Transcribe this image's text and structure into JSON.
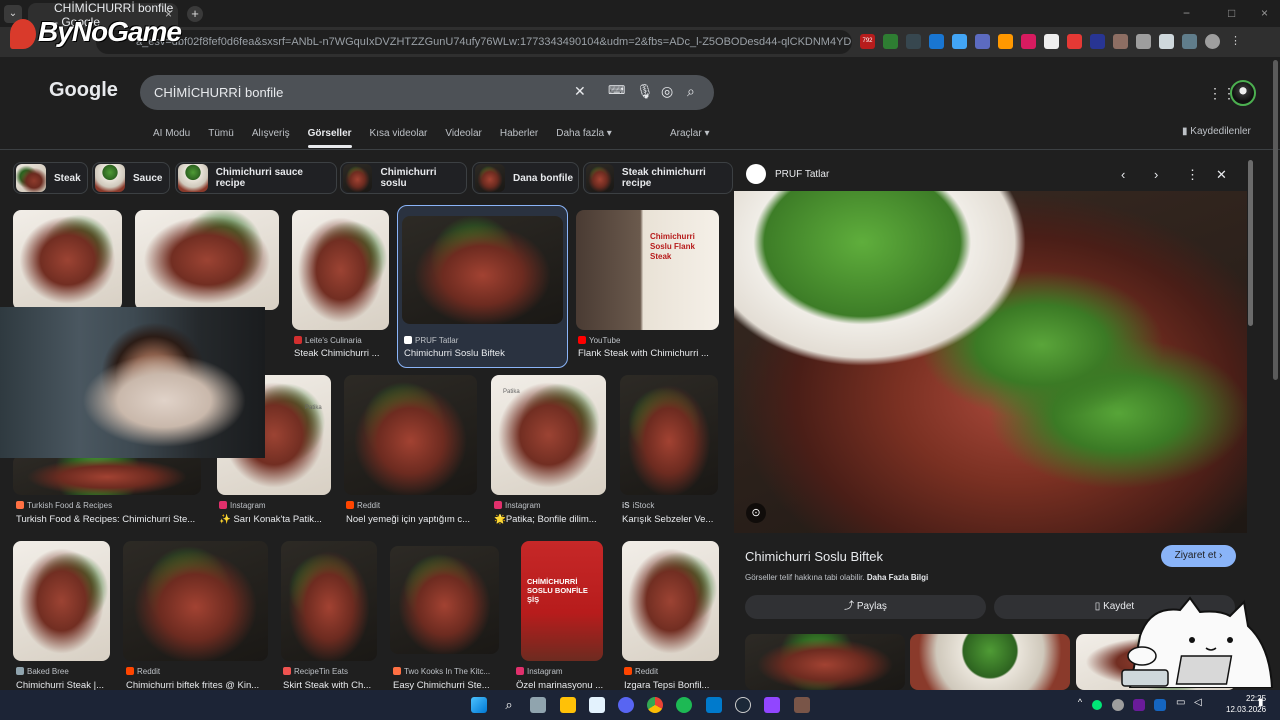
{
  "browser": {
    "tab_title": "CHİMİCHURRİ bonfile - Google",
    "tab_close": "×",
    "new_tab": "+",
    "tab_menu": "⌄",
    "url": "a_esv=dbf02f8fef0d6fea&sxsrf=ANbL-n7WGquIxDVZHTZZGunU74ufy76WLw:1773343490104&udm=2&fbs=ADc_l-Z5OBODesd44-qlCKDNM4YD...",
    "win_min": "−",
    "win_max": "□",
    "win_close": "×",
    "ext_badge": "792"
  },
  "overlay_logo": "ByNoGame",
  "google": {
    "logo": "Google",
    "query": "CHİMİCHURRİ bonfile",
    "nav_tabs": [
      "AI Modu",
      "Tümü",
      "Alışveriş",
      "Görseller",
      "Kısa videolar",
      "Videolar",
      "Haberler",
      "Daha fazla ▾"
    ],
    "tools": "Araçlar ▾",
    "saved": "Kaydedilenler"
  },
  "chips": [
    "Steak",
    "Sauce",
    "Chimichurri sauce recipe",
    "Chimichurri soslu",
    "Dana bonfile",
    "Steak chimichurri recipe"
  ],
  "results": [
    {
      "source": "",
      "title": ""
    },
    {
      "source": "",
      "title": ""
    },
    {
      "source": "Leite's Culinaria",
      "title": "Steak Chimichurri ..."
    },
    {
      "source": "PRUF Tatlar",
      "title": "Chimichurri Soslu Biftek"
    },
    {
      "source": "YouTube",
      "title": "Flank Steak with Chimichurri ..."
    },
    {
      "source": "Turkish Food & Recipes",
      "title": "Turkish Food & Recipes: Chimichurri Ste..."
    },
    {
      "source": "Instagram",
      "title": "✨ Sarı Konak'ta Patik..."
    },
    {
      "source": "Reddit",
      "title": "Noel yemeği için yaptığım c..."
    },
    {
      "source": "Instagram",
      "title": "🌟Patika; Bonfile dilim..."
    },
    {
      "source": "iStock",
      "title": "Karışık Sebzeler Ve..."
    },
    {
      "source": "Baked Bree",
      "title": "Chimichurri Steak |..."
    },
    {
      "source": "Reddit",
      "title": "Chimichurri biftek frites @ Kin..."
    },
    {
      "source": "RecipeTin Eats",
      "title": "Skirt Steak with Ch..."
    },
    {
      "source": "Two Kooks In The Kitc...",
      "title": "Easy Chimichurri Ste..."
    },
    {
      "source": "Instagram",
      "title": "Özel marinasyonu ..."
    },
    {
      "source": "Reddit",
      "title": "Izgara Tepsi Bonfil..."
    }
  ],
  "youtube_thumb_text": "Chimichurri Soslu Flank Steak",
  "istock_label": "iS",
  "poster_text": "CHİMİCHURRİ SOSLU BONFİLE ŞİŞ",
  "patika_label": "Patika",
  "panel": {
    "source": "PRUF Tatlar",
    "title": "Chimichurri Soslu Biftek",
    "note": "Görseller telif hakkına tabi olabilir.",
    "note_link": "Daha Fazla Bilgi",
    "visit": "Ziyaret et ›",
    "share": "Paylaş",
    "save": "Kaydet"
  },
  "taskbar": {
    "time": "22:25",
    "date": "12.03.2026"
  },
  "colors": {
    "accent": "#8ab4f8",
    "bg": "#1f1f1f",
    "selected_border": "#8ab4f8"
  }
}
